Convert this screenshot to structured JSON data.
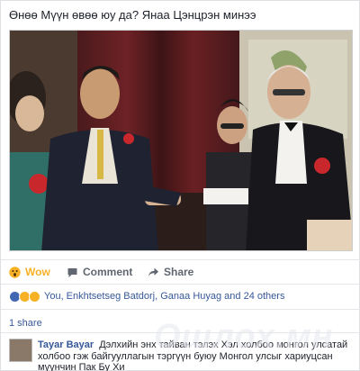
{
  "post": {
    "text": "Өнөө Мүүн өвөө юу да? Янаа Цэнцрэн минээ",
    "photo_alt": "photo"
  },
  "actions": {
    "wow_label": "Wow",
    "comment_label": "Comment",
    "share_label": "Share"
  },
  "reactions": {
    "summary": "You, Enkhtsetseg Batdorj, Ganaa Huyag and 24 others"
  },
  "shares": {
    "count_text": "1 share"
  },
  "comment": {
    "author": "Tayar Bayar",
    "text": "Дэлхийн энх тайван тэлэх Хэл холбоо монгол улсатай холбоо гэж байгууллагын тэргүүн буюу Монгол улсыг хариуцсан мүүнчин Пак Бу Хи"
  },
  "watermark": {
    "text": "Ошлох.мн"
  },
  "colors": {
    "link": "#365899",
    "wow": "#f7b125",
    "like": "#4267b2",
    "love": "#f25268"
  }
}
